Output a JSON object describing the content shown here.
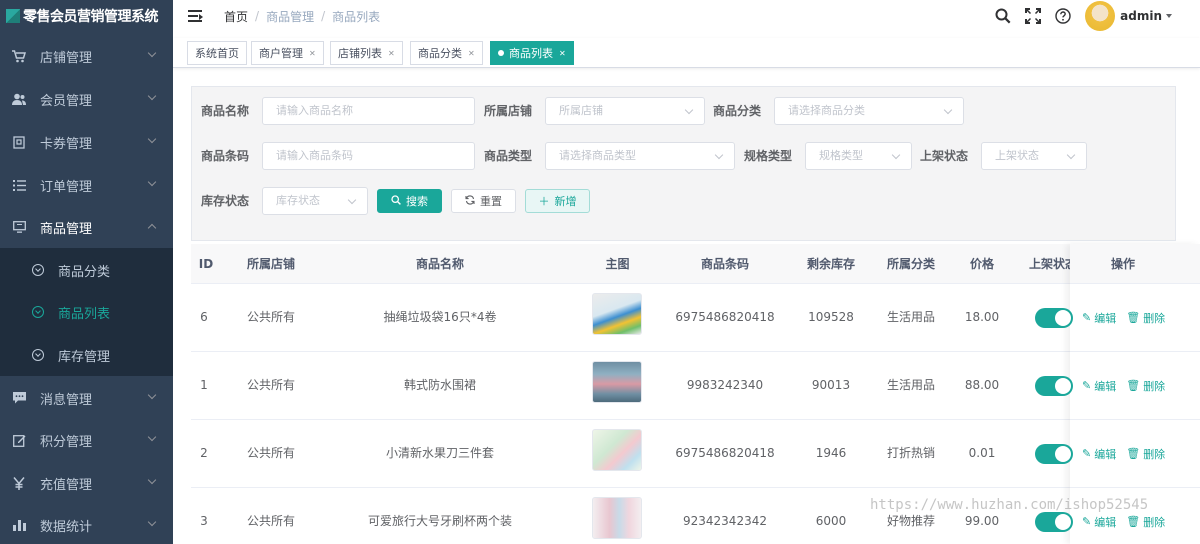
{
  "app": {
    "title": "零售会员营销管理系统"
  },
  "sidebar": {
    "menu": [
      {
        "label": "店铺管理",
        "icon": "cart-icon"
      },
      {
        "label": "会员管理",
        "icon": "users-icon"
      },
      {
        "label": "卡券管理",
        "icon": "coupon-icon"
      },
      {
        "label": "订单管理",
        "icon": "list-icon"
      },
      {
        "label": "商品管理",
        "icon": "monitor-icon"
      },
      {
        "label": "消息管理",
        "icon": "message-icon"
      },
      {
        "label": "积分管理",
        "icon": "edit-icon"
      },
      {
        "label": "充值管理",
        "icon": "yen-icon"
      },
      {
        "label": "数据统计",
        "icon": "chart-icon"
      }
    ],
    "submenu": [
      {
        "label": "商品分类"
      },
      {
        "label": "商品列表"
      },
      {
        "label": "库存管理"
      }
    ]
  },
  "header": {
    "breadcrumb": [
      "首页",
      "商品管理",
      "商品列表"
    ],
    "username": "admin"
  },
  "tags": [
    {
      "label": "系统首页"
    },
    {
      "label": "商户管理"
    },
    {
      "label": "店铺列表"
    },
    {
      "label": "商品分类"
    },
    {
      "label": "商品列表"
    }
  ],
  "search": {
    "name_label": "商品名称",
    "name_placeholder": "请输入商品名称",
    "shop_label": "所属店铺",
    "shop_placeholder": "所属店铺",
    "category_label": "商品分类",
    "category_placeholder": "请选择商品分类",
    "barcode_label": "商品条码",
    "barcode_placeholder": "请输入商品条码",
    "type_label": "商品类型",
    "type_placeholder": "请选择商品类型",
    "spec_label": "规格类型",
    "spec_placeholder": "规格类型",
    "shelf_label": "上架状态",
    "shelf_placeholder": "上架状态",
    "stock_label": "库存状态",
    "stock_placeholder": "库存状态",
    "search_button": "搜索",
    "reset_button": "重置",
    "add_button": "新增"
  },
  "table": {
    "columns": [
      "ID",
      "所属店铺",
      "商品名称",
      "主图",
      "商品条码",
      "剩余库存",
      "所属分类",
      "价格",
      "上架状态",
      "操作"
    ],
    "rows": [
      {
        "id": "6",
        "shop": "公共所有",
        "name": "抽绳垃圾袋16只*4卷",
        "barcode": "6975486820418",
        "stock": "109528",
        "category": "生活用品",
        "price": "18.00",
        "on_shelf": true
      },
      {
        "id": "1",
        "shop": "公共所有",
        "name": "韩式防水围裙",
        "barcode": "9983242340",
        "stock": "90013",
        "category": "生活用品",
        "price": "88.00",
        "on_shelf": true
      },
      {
        "id": "2",
        "shop": "公共所有",
        "name": "小清新水果刀三件套",
        "barcode": "6975486820418",
        "stock": "1946",
        "category": "打折热销",
        "price": "0.01",
        "on_shelf": true
      },
      {
        "id": "3",
        "shop": "公共所有",
        "name": "可爱旅行大号牙刷杯两个装",
        "barcode": "92342342342",
        "stock": "6000",
        "category": "好物推荐",
        "price": "99.00",
        "on_shelf": true
      }
    ],
    "edit_label": "编辑",
    "delete_label": "删除"
  },
  "watermark": "https://www.huzhan.com/ishop52545",
  "colors": {
    "accent": "#1aa79a",
    "sidebar": "#304156",
    "sidebar_sub": "#1f2d3d"
  }
}
